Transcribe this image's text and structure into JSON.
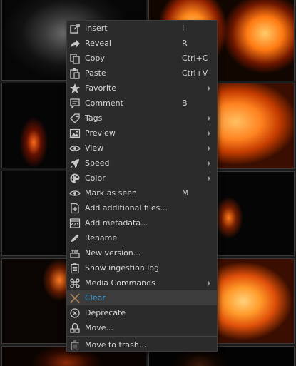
{
  "menu": {
    "items": [
      {
        "label": "Insert",
        "shortcut": "I",
        "icon": "insert-icon"
      },
      {
        "label": "Reveal",
        "shortcut": "R",
        "icon": "reveal-icon"
      },
      {
        "label": "Copy",
        "shortcut": "Ctrl+C",
        "icon": "copy-icon"
      },
      {
        "label": "Paste",
        "shortcut": "Ctrl+V",
        "icon": "paste-icon"
      },
      {
        "label": "Favorite",
        "shortcut": "",
        "icon": "star-icon",
        "submenu": true
      },
      {
        "label": "Comment",
        "shortcut": "B",
        "icon": "comment-icon"
      },
      {
        "label": "Tags",
        "shortcut": "",
        "icon": "tag-icon",
        "submenu": true
      },
      {
        "label": "Preview",
        "shortcut": "",
        "icon": "image-icon",
        "submenu": true
      },
      {
        "label": "View",
        "shortcut": "",
        "icon": "eye-icon",
        "submenu": true
      },
      {
        "label": "Speed",
        "shortcut": "",
        "icon": "rocket-icon",
        "submenu": true
      },
      {
        "label": "Color",
        "shortcut": "",
        "icon": "palette-icon",
        "submenu": true
      },
      {
        "label": "Mark as seen",
        "shortcut": "M",
        "icon": "eye-seen-icon"
      },
      {
        "label": "Add additional files...",
        "shortcut": "",
        "icon": "add-file-icon"
      },
      {
        "label": "Add metadata...",
        "shortcut": "",
        "icon": "metadata-icon"
      },
      {
        "label": "Rename",
        "shortcut": "",
        "icon": "pencil-icon"
      },
      {
        "label": "New version...",
        "shortcut": "",
        "icon": "new-version-icon"
      },
      {
        "label": "Show ingestion log",
        "shortcut": "",
        "icon": "log-icon"
      },
      {
        "label": "Media Commands",
        "shortcut": "",
        "icon": "command-icon",
        "submenu": true
      },
      {
        "label": "Clear",
        "shortcut": "",
        "icon": "clear-icon",
        "active": true
      },
      {
        "label": "Deprecate",
        "shortcut": "",
        "icon": "deprecate-icon"
      },
      {
        "label": "Move...",
        "shortcut": "",
        "icon": "move-icon"
      },
      {
        "label": "Move to trash...",
        "shortcut": "",
        "icon": "trash-icon"
      }
    ]
  },
  "colors": {
    "menu_bg": "#2b2b2b",
    "text": "#d7d7d7",
    "active_text": "#3aa3e3",
    "active_bg": "#3c3c3c"
  }
}
